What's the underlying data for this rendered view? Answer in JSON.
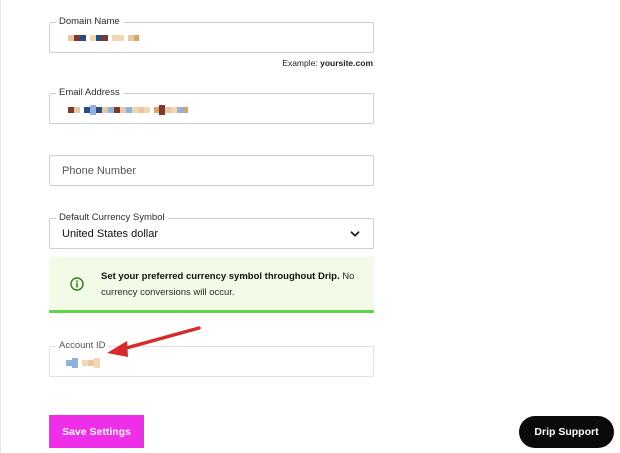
{
  "form": {
    "domain": {
      "label": "Domain Name",
      "example_prefix": "Example:",
      "example_value": "yoursite.com"
    },
    "email": {
      "label": "Email Address"
    },
    "phone": {
      "placeholder": "Phone Number"
    },
    "currency": {
      "label": "Default Currency Symbol",
      "value": "United States dollar"
    },
    "callout": {
      "bold": "Set your preferred currency symbol throughout Drip.",
      "rest": " No currency conversions will occur."
    },
    "account": {
      "label": "Account ID"
    }
  },
  "buttons": {
    "save_label": "Save Settings",
    "support_label": "Drip Support"
  },
  "colors": {
    "save_bg": "#ee2ee8",
    "support_bg": "#0a0a0a",
    "callout_bg": "#f1fbe6",
    "callout_border": "#5ed84a",
    "arrow": "#d62b2b",
    "info_icon": "#2e7d1f"
  },
  "icons": {
    "currency_select": "chevron-down-icon",
    "callout": "info-circle-icon",
    "annotation": "red-arrow-icon"
  }
}
